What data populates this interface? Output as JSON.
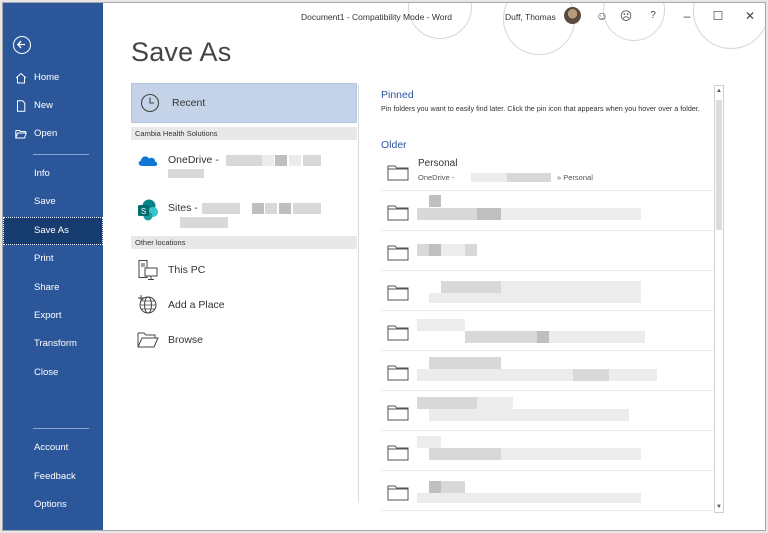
{
  "titlebar": {
    "document": "Document1  -  Compatibility Mode  -  Word",
    "user": "Duff, Thomas",
    "smile": "☺",
    "frown": "☹",
    "help": "?",
    "minimize": "–",
    "restore": "☐",
    "close": "✕"
  },
  "rail": {
    "items": [
      {
        "label": "Home"
      },
      {
        "label": "New"
      },
      {
        "label": "Open"
      },
      {
        "label": "Info"
      },
      {
        "label": "Save"
      },
      {
        "label": "Save As"
      },
      {
        "label": "Print"
      },
      {
        "label": "Share"
      },
      {
        "label": "Export"
      },
      {
        "label": "Transform"
      },
      {
        "label": "Close"
      },
      {
        "label": "Account"
      },
      {
        "label": "Feedback"
      },
      {
        "label": "Options"
      }
    ]
  },
  "page": {
    "heading": "Save As"
  },
  "locations": {
    "recent": "Recent",
    "org_header": "Cambia Health Solutions",
    "onedrive": "OneDrive -",
    "sites": "Sites -",
    "other_header": "Other locations",
    "this_pc": "This PC",
    "add_place": "Add a Place",
    "browse": "Browse"
  },
  "right": {
    "pinned_title": "Pinned",
    "pinned_hint": "Pin folders you want to easily find later. Click the pin icon that appears when you hover over a folder.",
    "older_title": "Older",
    "folders": [
      {
        "name": "Personal",
        "path": "OneDrive -",
        "path_suffix": "» Personal"
      }
    ]
  },
  "colors": {
    "rail": "#2b579a",
    "accent": "#2b579a",
    "selected": "#c5d3e8"
  }
}
